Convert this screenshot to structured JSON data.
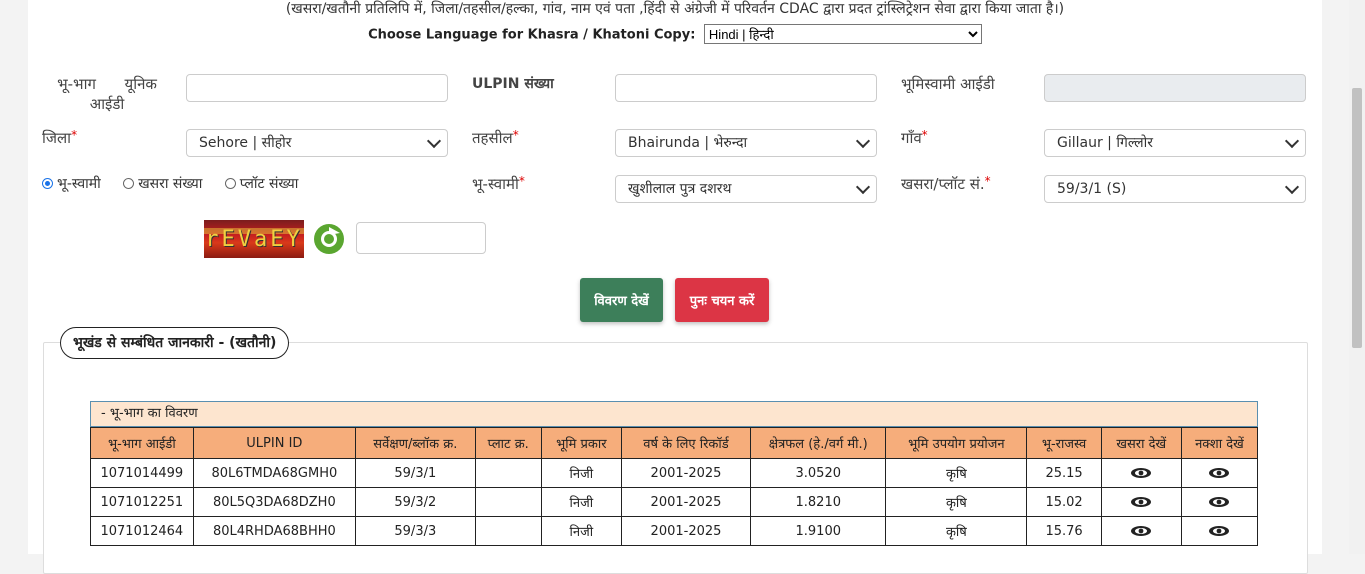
{
  "info_note": "(खसरा/खतौनी प्रतिलिपि में, जिला/तहसील/हल्का, गांव, नाम एवं पता ,हिंदी से अंग्रेजी में परिवर्तन CDAC द्वारा प्रदत ट्रांस्लिट्रेशन सेवा द्वारा किया जाता है।)",
  "language": {
    "label": "Choose Language for Khasra / Khatoni Copy:",
    "selected": "Hindi | हिन्दी"
  },
  "form": {
    "parcel_id_label": "भू-भाग      यूनिक आईडी",
    "parcel_id_line1": "भू-भाग      यूनिक",
    "parcel_id_line2": "आईडी",
    "parcel_id_value": "",
    "ulpin_label": "ULPIN संख्या",
    "ulpin_value": "",
    "owner_id_label": "भूमिस्वामी आईडी",
    "owner_id_value": "",
    "district_label": "जिला",
    "district_value": "Sehore | सीहोर",
    "tehsil_label": "तहसील",
    "tehsil_value": "Bhairunda | भेरुन्दा",
    "village_label": "गाँव",
    "village_value": "Gillaur | गिल्लोर",
    "search_by": [
      "भू-स्वामी",
      "खसरा संख्या",
      "प्लॉट संख्या"
    ],
    "search_by_selected": 0,
    "owner_label": "भू-स्वामी",
    "owner_value": "खुशीलाल पुत्र दशरथ",
    "khasra_label": "खसरा/प्लॉट सं.",
    "khasra_value": "59/3/1 (S)",
    "required_mark": "*",
    "captcha_text": "rEVaEY",
    "captcha_input": ""
  },
  "buttons": {
    "view": "विवरण देखें",
    "reset": "पुनः चयन करें"
  },
  "panel": {
    "title": "भूखंड से सम्बंधित जानकारी -   (खतौनी)",
    "table_caption": "- भू-भाग का विवरण",
    "columns": [
      "भू-भाग आईडी",
      "ULPIN ID",
      "सर्वेक्षण/ब्लॉक क्र.",
      "प्लाट क्र.",
      "भूमि प्रकार",
      "वर्ष के लिए रिकॉर्ड",
      "क्षेत्रफल (हे./वर्ग मी.)",
      "भूमि उपयोग प्रयोजन",
      "भू-राजस्व",
      "खसरा देखें",
      "नक्शा देखें"
    ],
    "rows": [
      [
        "1071014499",
        "80L6TMDA68GMH0",
        "59/3/1",
        "",
        "निजी",
        "2001-2025",
        "3.0520",
        "कृषि",
        "25.15"
      ],
      [
        "1071012251",
        "80L5Q3DA68DZH0",
        "59/3/2",
        "",
        "निजी",
        "2001-2025",
        "1.8210",
        "कृषि",
        "15.02"
      ],
      [
        "1071012464",
        "80L4RHDA68BHH0",
        "59/3/3",
        "",
        "निजी",
        "2001-2025",
        "1.9100",
        "कृषि",
        "15.76"
      ]
    ]
  },
  "icons": {
    "view_khasra": "eye-icon",
    "view_map": "eye-icon",
    "refresh_captcha": "refresh-icon"
  },
  "colors": {
    "view_button": "#3d7f5a",
    "reset_button": "#dc3545",
    "table_header": "#f6ad7b",
    "caption_bg": "#fde5cf"
  }
}
